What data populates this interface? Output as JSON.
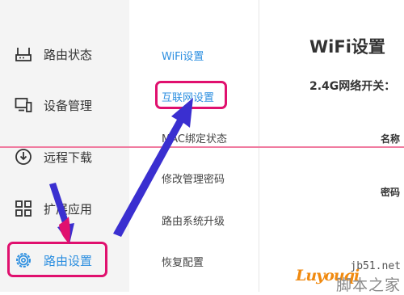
{
  "sidebar": {
    "items": [
      {
        "label": "路由状态",
        "icon": "router-icon"
      },
      {
        "label": "设备管理",
        "icon": "monitor-icon"
      },
      {
        "label": "远程下载",
        "icon": "download-icon"
      },
      {
        "label": "扩展应用",
        "icon": "grid-apps-icon"
      },
      {
        "label": "路由设置",
        "icon": "gear-icon",
        "active": true
      }
    ]
  },
  "submenu": {
    "items": [
      {
        "label": "WiFi设置"
      },
      {
        "label": "互联网设置"
      },
      {
        "label": "MAC绑定状态"
      },
      {
        "label": "修改管理密码"
      },
      {
        "label": "路由系统升级"
      },
      {
        "label": "恢复配置"
      }
    ]
  },
  "main": {
    "title": "WiFi设置",
    "switch_label": "2.4G网络开关：",
    "name_label": "名称",
    "password_label": "密码"
  },
  "watermark": {
    "top": "jb51.net",
    "main": "Luyouqi",
    "cn": "脚本之家"
  },
  "colors": {
    "accent": "#2d8fe0",
    "highlight": "#e0106e",
    "arrow_blue": "#3a2fd0"
  }
}
